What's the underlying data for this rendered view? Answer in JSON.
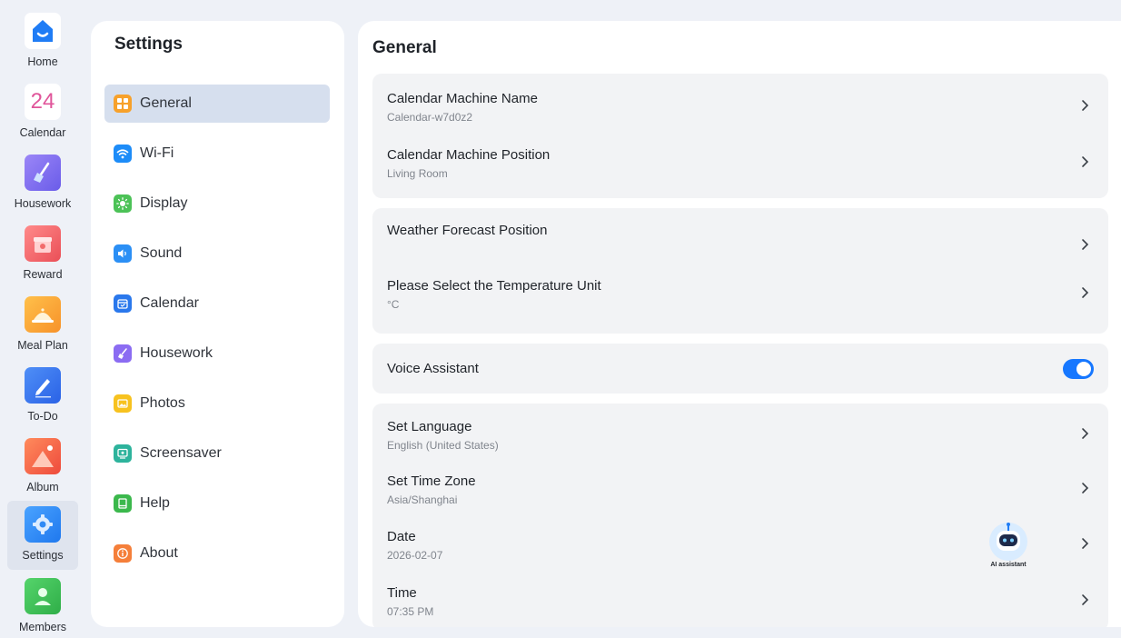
{
  "rail": {
    "items": [
      {
        "label": "Home",
        "icon": "home-icon",
        "color": "#1f7cf5"
      },
      {
        "label": "Calendar",
        "icon": "calendar-24-icon",
        "color": "#e0559a",
        "icon_text": "24"
      },
      {
        "label": "Housework",
        "icon": "broom-icon",
        "color": "#8a6ff0"
      },
      {
        "label": "Reward",
        "icon": "gift-icon",
        "color": "#f26b6b"
      },
      {
        "label": "Meal Plan",
        "icon": "cloche-icon",
        "color": "#f7a83a"
      },
      {
        "label": "To-Do",
        "icon": "pencil-icon",
        "color": "#2f6ff0"
      },
      {
        "label": "Album",
        "icon": "mountain-image-icon",
        "color": "#f46a4a"
      },
      {
        "label": "Settings",
        "icon": "gear-icon",
        "color": "#2f8af5",
        "active": true
      },
      {
        "label": "Members",
        "icon": "person-icon",
        "color": "#3cc05a"
      }
    ]
  },
  "menu": {
    "title": "Settings",
    "items": [
      {
        "label": "General",
        "icon": "grid-icon",
        "color": "#f7a12b",
        "active": true
      },
      {
        "label": "Wi-Fi",
        "icon": "wifi-icon",
        "color": "#1d8cf8"
      },
      {
        "label": "Display",
        "icon": "sun-icon",
        "color": "#4cc257"
      },
      {
        "label": "Sound",
        "icon": "speaker-icon",
        "color": "#2b8ff5"
      },
      {
        "label": "Calendar",
        "icon": "calendar-icon",
        "color": "#2a78ec"
      },
      {
        "label": "Housework",
        "icon": "broom-icon",
        "color": "#8b6cf2"
      },
      {
        "label": "Photos",
        "icon": "image-icon",
        "color": "#f7c21f"
      },
      {
        "label": "Screensaver",
        "icon": "monitor-icon",
        "color": "#2db39c"
      },
      {
        "label": "Help",
        "icon": "book-icon",
        "color": "#3bb84c"
      },
      {
        "label": "About",
        "icon": "info-icon",
        "color": "#f57f3a"
      }
    ]
  },
  "content": {
    "title": "General",
    "rows": {
      "machine_name": {
        "title": "Calendar Machine Name",
        "sub": "Calendar-w7d0z2"
      },
      "machine_position": {
        "title": "Calendar Machine Position",
        "sub": "Living Room"
      },
      "weather_position": {
        "title": "Weather Forecast Position"
      },
      "temperature_unit": {
        "title": "Please Select the Temperature Unit",
        "sub": "°C"
      },
      "voice_assistant": {
        "title": "Voice Assistant",
        "enabled": true
      },
      "language": {
        "title": "Set Language",
        "sub": "English (United States)"
      },
      "time_zone": {
        "title": "Set Time Zone",
        "sub": "Asia/Shanghai"
      },
      "date": {
        "title": "Date",
        "sub": "2026-02-07"
      },
      "time": {
        "title": "Time",
        "sub": "07:35 PM"
      }
    },
    "ai_assistant_label": "AI assistant"
  },
  "colors": {
    "accent": "#1677ff",
    "active_menu_bg": "#d6dfee",
    "page_bg": "#eef1f7"
  }
}
